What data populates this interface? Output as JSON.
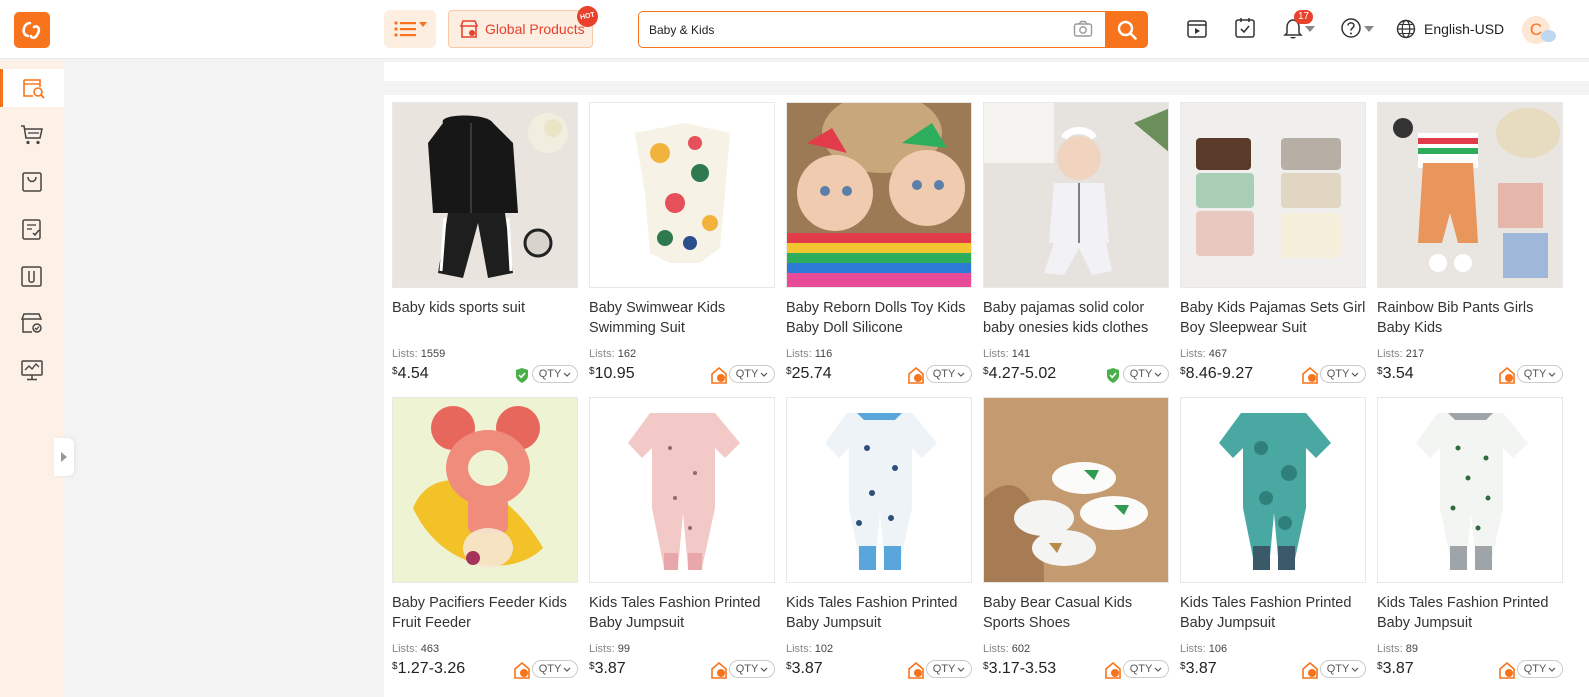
{
  "header": {
    "global_products": "Global Products",
    "hot": "HOT",
    "search_value": "Baby & Kids",
    "notification_count": "17",
    "language": "English-USD",
    "avatar_letter": "C"
  },
  "sidebar": {
    "icons": [
      "product-search-icon",
      "cart-icon",
      "bag-icon",
      "orders-icon",
      "paperclip-icon",
      "store-icon",
      "analytics-icon"
    ]
  },
  "colors": {
    "accent": "#f7741c",
    "hot_red": "#e8412c",
    "sidebar_bg": "#fdf1e7"
  },
  "products": [
    {
      "title": "Baby kids sports suit",
      "lists_label": "Lists:",
      "lists": "1559",
      "currency": "$",
      "price": "4.54",
      "badge": "green",
      "qty": "QTY"
    },
    {
      "title": "Baby Swimwear Kids Swimming Suit",
      "lists_label": "Lists:",
      "lists": "162",
      "currency": "$",
      "price": "10.95",
      "badge": "orange",
      "qty": "QTY"
    },
    {
      "title": "Baby Reborn Dolls Toy Kids Baby Doll Silicone",
      "lists_label": "Lists:",
      "lists": "116",
      "currency": "$",
      "price": "25.74",
      "badge": "orange",
      "qty": "QTY"
    },
    {
      "title": "Baby pajamas solid color baby onesies kids clothes",
      "lists_label": "Lists:",
      "lists": "141",
      "currency": "$",
      "price": "4.27-5.02",
      "badge": "green",
      "qty": "QTY"
    },
    {
      "title": "Baby Kids Pajamas Sets Girl Boy Sleepwear Suit Autum…",
      "lists_label": "Lists:",
      "lists": "467",
      "currency": "$",
      "price": "8.46-9.27",
      "badge": "orange",
      "qty": "QTY"
    },
    {
      "title": "Rainbow Bib Pants Girls Baby Kids",
      "lists_label": "Lists:",
      "lists": "217",
      "currency": "$",
      "price": "3.54",
      "badge": "orange",
      "qty": "QTY"
    },
    {
      "title": "Baby Pacifiers Feeder Kids Fruit Feeder",
      "lists_label": "Lists:",
      "lists": "463",
      "currency": "$",
      "price": "1.27-3.26",
      "badge": "orange",
      "qty": "QTY"
    },
    {
      "title": "Kids Tales Fashion Printed Baby Jumpsuit",
      "lists_label": "Lists:",
      "lists": "99",
      "currency": "$",
      "price": "3.87",
      "badge": "orange",
      "qty": "QTY"
    },
    {
      "title": "Kids Tales Fashion Printed Baby Jumpsuit",
      "lists_label": "Lists:",
      "lists": "102",
      "currency": "$",
      "price": "3.87",
      "badge": "orange",
      "qty": "QTY"
    },
    {
      "title": "Baby Bear Casual Kids Sports Shoes",
      "lists_label": "Lists:",
      "lists": "602",
      "currency": "$",
      "price": "3.17-3.53",
      "badge": "orange",
      "qty": "QTY"
    },
    {
      "title": "Kids Tales Fashion Printed Baby Jumpsuit",
      "lists_label": "Lists:",
      "lists": "106",
      "currency": "$",
      "price": "3.87",
      "badge": "orange",
      "qty": "QTY"
    },
    {
      "title": "Kids Tales Fashion Printed Baby Jumpsuit",
      "lists_label": "Lists:",
      "lists": "89",
      "currency": "$",
      "price": "3.87",
      "badge": "orange",
      "qty": "QTY"
    }
  ]
}
